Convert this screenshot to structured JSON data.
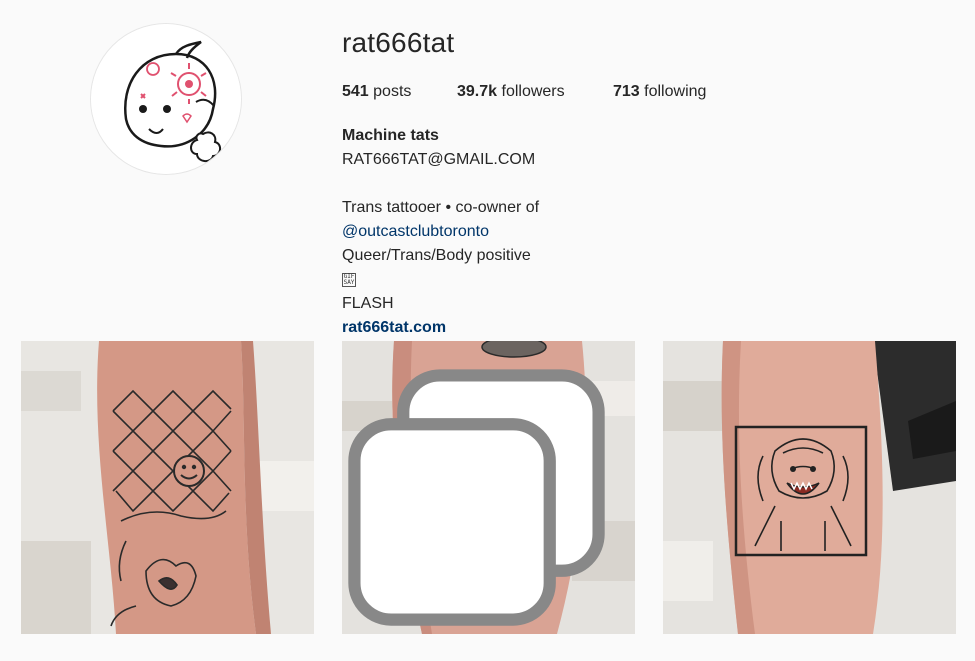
{
  "profile": {
    "username": "rat666tat",
    "avatar_icon": "kewpie-tattoo-avatar"
  },
  "stats": {
    "posts_count": "541",
    "posts_label": "posts",
    "followers_count": "39.7k",
    "followers_label": "followers",
    "following_count": "713",
    "following_label": "following"
  },
  "bio": {
    "full_name": "Machine tats",
    "email": "RAT666TAT@GMAIL.COM",
    "line1": "Trans tattooer • co-owner of",
    "mention": "@outcastclubtoronto",
    "line3": "Queer/Trans/Body positive",
    "gif_icon": "gif-sticker-icon",
    "line5": "FLASH",
    "website": "rat666tat.com"
  },
  "posts": [
    {
      "description_icon": "fishnet-smiley-tattoo-photo",
      "multi": false
    },
    {
      "description_icon": "poppy-tattoo-photo",
      "multi": true
    },
    {
      "description_icon": "monster-framed-tattoo-photo",
      "multi": false
    }
  ],
  "colors": {
    "background": "#fafafa",
    "text": "#262626",
    "link": "#003569",
    "skin": "#d9a394",
    "wall": "#e8e6e2",
    "poppy_red": "#d9262b"
  }
}
